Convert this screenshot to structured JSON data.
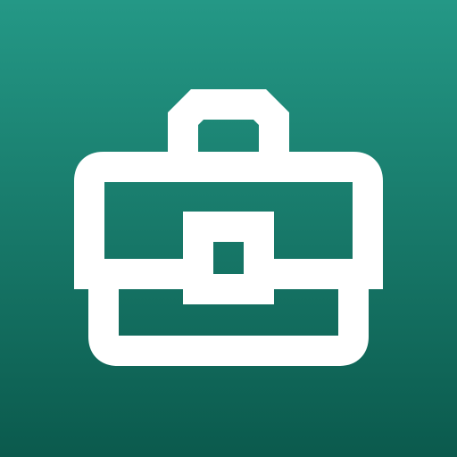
{
  "icon": {
    "name": "briefcase-icon",
    "background_gradient": [
      "#249886",
      "#0b5a4d"
    ],
    "glyph_color": "#ffffff"
  }
}
